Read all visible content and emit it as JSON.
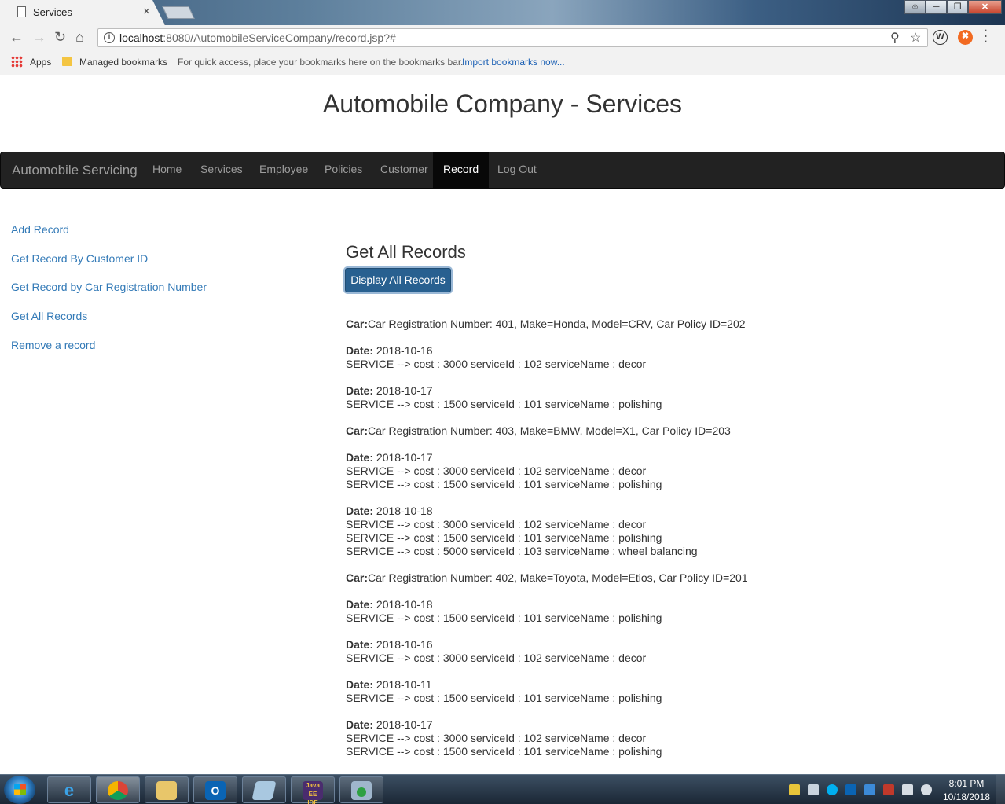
{
  "browser": {
    "tab_title": "Services",
    "tab_close": "×",
    "url_host": "localhost",
    "url_path": ":8080/AutomobileServiceCompany/record.jsp?#",
    "bookmarks": {
      "apps": "Apps",
      "managed": "Managed bookmarks",
      "hint": "For quick access, place your bookmarks here on the bookmarks bar.",
      "import": "Import bookmarks now..."
    }
  },
  "page": {
    "title": "Automobile Company - Services"
  },
  "navbar": {
    "brand": "Automobile Servicing",
    "items": [
      "Home",
      "Services",
      "Employee",
      "Policies",
      "Customer",
      "Record",
      "Log Out"
    ],
    "active": "Record"
  },
  "sidebar": {
    "links": [
      "Add Record",
      "Get Record By Customer ID",
      "Get Record by Car Registration Number",
      "Get All Records",
      "Remove a record"
    ]
  },
  "main": {
    "heading": "Get All Records",
    "button": "Display All Records",
    "car_label": "Car:",
    "date_label": "Date:",
    "cars": [
      {
        "info": "Car Registration Number: 401, Make=Honda, Model=CRV, Car Policy ID=202",
        "dates": [
          {
            "date": "2018-10-16",
            "services": [
              "SERVICE --> cost : 3000 serviceId : 102 serviceName : decor"
            ]
          },
          {
            "date": "2018-10-17",
            "services": [
              "SERVICE --> cost : 1500 serviceId : 101 serviceName : polishing"
            ]
          }
        ]
      },
      {
        "info": "Car Registration Number: 403, Make=BMW, Model=X1, Car Policy ID=203",
        "dates": [
          {
            "date": "2018-10-17",
            "services": [
              "SERVICE --> cost : 3000 serviceId : 102 serviceName : decor",
              "SERVICE --> cost : 1500 serviceId : 101 serviceName : polishing"
            ]
          },
          {
            "date": "2018-10-18",
            "services": [
              "SERVICE --> cost : 3000 serviceId : 102 serviceName : decor",
              "SERVICE --> cost : 1500 serviceId : 101 serviceName : polishing",
              "SERVICE --> cost : 5000 serviceId : 103 serviceName : wheel balancing"
            ]
          }
        ]
      },
      {
        "info": "Car Registration Number: 402, Make=Toyota, Model=Etios, Car Policy ID=201",
        "dates": [
          {
            "date": "2018-10-18",
            "services": [
              "SERVICE --> cost : 1500 serviceId : 101 serviceName : polishing"
            ]
          },
          {
            "date": "2018-10-16",
            "services": [
              "SERVICE --> cost : 3000 serviceId : 102 serviceName : decor"
            ]
          },
          {
            "date": "2018-10-11",
            "services": [
              "SERVICE --> cost : 1500 serviceId : 101 serviceName : polishing"
            ]
          },
          {
            "date": "2018-10-17",
            "services": [
              "SERVICE --> cost : 3000 serviceId : 102 serviceName : decor",
              "SERVICE --> cost : 1500 serviceId : 101 serviceName : polishing"
            ]
          }
        ]
      }
    ]
  },
  "taskbar": {
    "time": "8:01 PM",
    "date": "10/18/2018",
    "apps": [
      "internet-explorer-icon",
      "chrome-icon",
      "file-explorer-icon",
      "outlook-icon",
      "notepad-icon",
      "java-ee-ide-icon",
      "virtual-machine-icon"
    ]
  },
  "colors": {
    "link": "#337ab7",
    "navbar_bg": "#222222",
    "button_bg": "#286090"
  }
}
